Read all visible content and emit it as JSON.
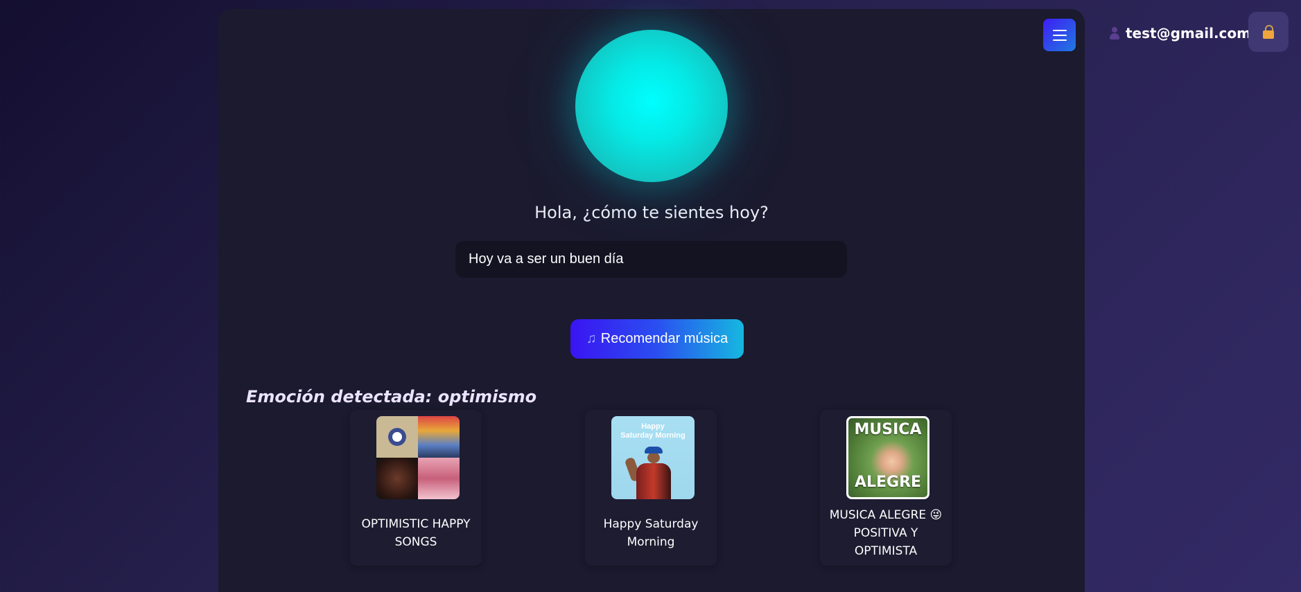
{
  "header": {
    "user_email": "test@gmail.com",
    "menu_icon": "hamburger-menu-icon",
    "lock_icon": "lock-icon",
    "user_icon": "user-silhouette-icon"
  },
  "main": {
    "greeting": "Hola, ¿cómo te sientes hoy?",
    "mood_input_value": "Hoy va a ser un buen día",
    "recommend_button_label": "Recomendar música",
    "recommend_button_icon": "music-note-icon",
    "emotion_label": "Emoción detectada: optimismo"
  },
  "playlists": [
    {
      "title_line1": "OPTIMISTIC HAPPY",
      "title_line2": "SONGS",
      "title_line3": ""
    },
    {
      "title_line1": "Happy Saturday",
      "title_line2": "Morning",
      "title_line3": ""
    },
    {
      "title_line1": "MUSICA ALEGRE 😜",
      "title_line2": "POSITIVA Y",
      "title_line3": "OPTIMISTA"
    }
  ],
  "covers": {
    "cover2_text": "Happy\nSaturday Morning",
    "cover3_top": "MUSICA",
    "cover3_bottom": "ALEGRE"
  },
  "colors": {
    "accent_start": "#3a14f2",
    "accent_end": "#16b8e0",
    "orb": "#00ffff",
    "panel": "#1b1a2e"
  }
}
